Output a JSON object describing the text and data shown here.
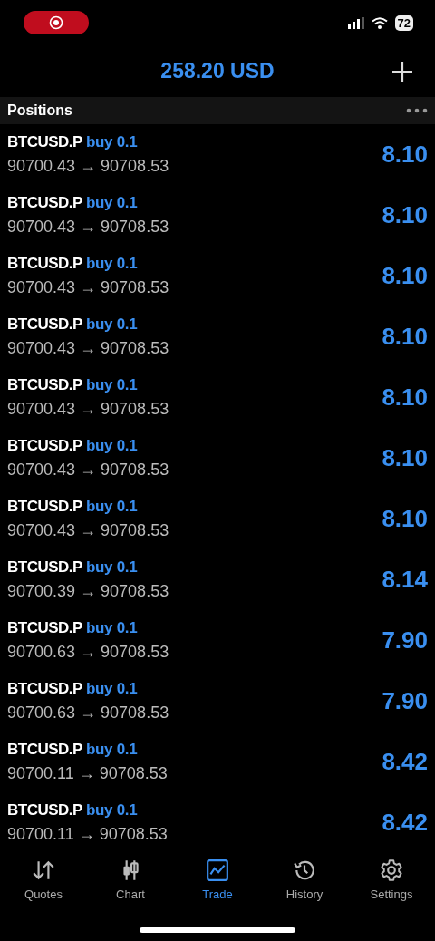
{
  "status_bar": {
    "battery": "72"
  },
  "header": {
    "title": "258.20 USD"
  },
  "section": {
    "title": "Positions"
  },
  "positions": [
    {
      "symbol": "BTCUSD.P",
      "side": "buy 0.1",
      "prices": "90700.43 → 90708.53",
      "profit": "8.10"
    },
    {
      "symbol": "BTCUSD.P",
      "side": "buy 0.1",
      "prices": "90700.43 → 90708.53",
      "profit": "8.10"
    },
    {
      "symbol": "BTCUSD.P",
      "side": "buy 0.1",
      "prices": "90700.43 → 90708.53",
      "profit": "8.10"
    },
    {
      "symbol": "BTCUSD.P",
      "side": "buy 0.1",
      "prices": "90700.43 → 90708.53",
      "profit": "8.10"
    },
    {
      "symbol": "BTCUSD.P",
      "side": "buy 0.1",
      "prices": "90700.43 → 90708.53",
      "profit": "8.10"
    },
    {
      "symbol": "BTCUSD.P",
      "side": "buy 0.1",
      "prices": "90700.43 → 90708.53",
      "profit": "8.10"
    },
    {
      "symbol": "BTCUSD.P",
      "side": "buy 0.1",
      "prices": "90700.43 → 90708.53",
      "profit": "8.10"
    },
    {
      "symbol": "BTCUSD.P",
      "side": "buy 0.1",
      "prices": "90700.39 → 90708.53",
      "profit": "8.14"
    },
    {
      "symbol": "BTCUSD.P",
      "side": "buy 0.1",
      "prices": "90700.63 → 90708.53",
      "profit": "7.90"
    },
    {
      "symbol": "BTCUSD.P",
      "side": "buy 0.1",
      "prices": "90700.63 → 90708.53",
      "profit": "7.90"
    },
    {
      "symbol": "BTCUSD.P",
      "side": "buy 0.1",
      "prices": "90700.11 → 90708.53",
      "profit": "8.42"
    },
    {
      "symbol": "BTCUSD.P",
      "side": "buy 0.1",
      "prices": "90700.11 → 90708.53",
      "profit": "8.42"
    }
  ],
  "tabs": [
    {
      "kind": "quotes",
      "label": "Quotes",
      "selected": false
    },
    {
      "kind": "chart",
      "label": "Chart",
      "selected": false
    },
    {
      "kind": "trade",
      "label": "Trade",
      "selected": true
    },
    {
      "kind": "history",
      "label": "History",
      "selected": false
    },
    {
      "kind": "settings",
      "label": "Settings",
      "selected": false
    }
  ]
}
